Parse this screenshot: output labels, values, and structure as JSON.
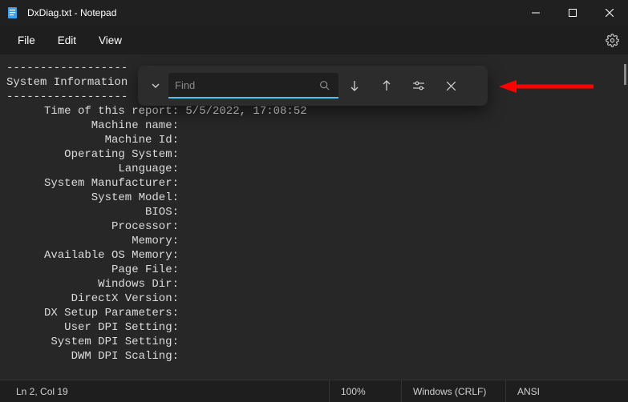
{
  "titlebar": {
    "title": "DxDiag.txt - Notepad"
  },
  "menu": {
    "file": "File",
    "edit": "Edit",
    "view": "View"
  },
  "find": {
    "placeholder": "Find"
  },
  "content": {
    "dash_line": "------------------",
    "header": "System Information",
    "lines": [
      {
        "label": "Time of this report:",
        "value": "5/5/2022, 17:08:52"
      },
      {
        "label": "Machine name:",
        "value": ""
      },
      {
        "label": "Machine Id:",
        "value": ""
      },
      {
        "label": "Operating System:",
        "value": ""
      },
      {
        "label": "Language:",
        "value": ""
      },
      {
        "label": "System Manufacturer:",
        "value": ""
      },
      {
        "label": "System Model:",
        "value": ""
      },
      {
        "label": "BIOS:",
        "value": ""
      },
      {
        "label": "Processor:",
        "value": ""
      },
      {
        "label": "Memory:",
        "value": ""
      },
      {
        "label": "Available OS Memory:",
        "value": ""
      },
      {
        "label": "Page File:",
        "value": ""
      },
      {
        "label": "Windows Dir:",
        "value": ""
      },
      {
        "label": "DirectX Version:",
        "value": ""
      },
      {
        "label": "DX Setup Parameters:",
        "value": ""
      },
      {
        "label": "User DPI Setting:",
        "value": ""
      },
      {
        "label": "System DPI Setting:",
        "value": ""
      },
      {
        "label": "DWM DPI Scaling:",
        "value": ""
      }
    ]
  },
  "status": {
    "cursor": "Ln 2, Col 19",
    "zoom": "100%",
    "eol": "Windows (CRLF)",
    "encoding": "ANSI"
  }
}
